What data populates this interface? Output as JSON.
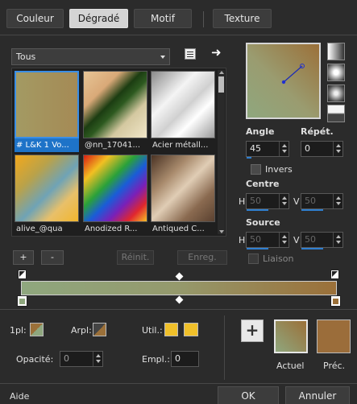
{
  "tabs": [
    {
      "label": "Couleur"
    },
    {
      "label": "Dégradé",
      "active": true
    },
    {
      "label": "Motif"
    },
    {
      "label": "Texture"
    }
  ],
  "gallery": {
    "category": "Tous",
    "tiles": [
      {
        "label": "# L&K 1 Vo...",
        "selected": true
      },
      {
        "label": "@nn_17041..."
      },
      {
        "label": "Acier métall..."
      },
      {
        "label": "alive_@qua"
      },
      {
        "label": "Anodized R..."
      },
      {
        "label": "Antiqued C..."
      }
    ]
  },
  "stop_buttons": {
    "add": "+",
    "remove": "-",
    "reset": "Réinit.",
    "save": "Enreg."
  },
  "params": {
    "angle_label": "Angle",
    "angle_value": "45",
    "repeat_label": "Répét.",
    "repeat_value": "0",
    "invert_label": "Invers",
    "center_label": "Centre",
    "center_h": "50",
    "center_v": "50",
    "source_label": "Source",
    "source_h": "50",
    "source_v": "50",
    "h_label": "H",
    "v_label": "V",
    "link_label": "Liaison"
  },
  "bottom": {
    "fg_label": "1pl:",
    "bg_label": "Arpl:",
    "user_label": "Util.:",
    "opacity_label": "Opacité:",
    "opacity_value": "0",
    "location_label": "Empl.:",
    "location_value": "0",
    "add_button": "+",
    "current_label": "Actuel",
    "previous_label": "Préc."
  },
  "footer": {
    "help": "Aide",
    "ok": "OK",
    "cancel": "Annuler"
  },
  "colors": {
    "gradient_start": "#8fa77e",
    "gradient_end": "#9b7039",
    "selection_blue": "#1e73c8",
    "user_swatch": "#f0c02a"
  }
}
